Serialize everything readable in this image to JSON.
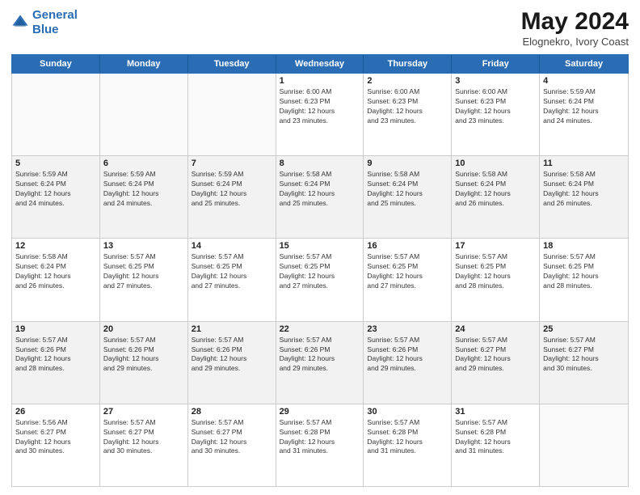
{
  "header": {
    "logo_line1": "General",
    "logo_line2": "Blue",
    "main_title": "May 2024",
    "subtitle": "Elognekro, Ivory Coast"
  },
  "days_of_week": [
    "Sunday",
    "Monday",
    "Tuesday",
    "Wednesday",
    "Thursday",
    "Friday",
    "Saturday"
  ],
  "weeks": [
    [
      {
        "day": "",
        "info": ""
      },
      {
        "day": "",
        "info": ""
      },
      {
        "day": "",
        "info": ""
      },
      {
        "day": "1",
        "info": "Sunrise: 6:00 AM\nSunset: 6:23 PM\nDaylight: 12 hours\nand 23 minutes."
      },
      {
        "day": "2",
        "info": "Sunrise: 6:00 AM\nSunset: 6:23 PM\nDaylight: 12 hours\nand 23 minutes."
      },
      {
        "day": "3",
        "info": "Sunrise: 6:00 AM\nSunset: 6:23 PM\nDaylight: 12 hours\nand 23 minutes."
      },
      {
        "day": "4",
        "info": "Sunrise: 5:59 AM\nSunset: 6:24 PM\nDaylight: 12 hours\nand 24 minutes."
      }
    ],
    [
      {
        "day": "5",
        "info": "Sunrise: 5:59 AM\nSunset: 6:24 PM\nDaylight: 12 hours\nand 24 minutes."
      },
      {
        "day": "6",
        "info": "Sunrise: 5:59 AM\nSunset: 6:24 PM\nDaylight: 12 hours\nand 24 minutes."
      },
      {
        "day": "7",
        "info": "Sunrise: 5:59 AM\nSunset: 6:24 PM\nDaylight: 12 hours\nand 25 minutes."
      },
      {
        "day": "8",
        "info": "Sunrise: 5:58 AM\nSunset: 6:24 PM\nDaylight: 12 hours\nand 25 minutes."
      },
      {
        "day": "9",
        "info": "Sunrise: 5:58 AM\nSunset: 6:24 PM\nDaylight: 12 hours\nand 25 minutes."
      },
      {
        "day": "10",
        "info": "Sunrise: 5:58 AM\nSunset: 6:24 PM\nDaylight: 12 hours\nand 26 minutes."
      },
      {
        "day": "11",
        "info": "Sunrise: 5:58 AM\nSunset: 6:24 PM\nDaylight: 12 hours\nand 26 minutes."
      }
    ],
    [
      {
        "day": "12",
        "info": "Sunrise: 5:58 AM\nSunset: 6:24 PM\nDaylight: 12 hours\nand 26 minutes."
      },
      {
        "day": "13",
        "info": "Sunrise: 5:57 AM\nSunset: 6:25 PM\nDaylight: 12 hours\nand 27 minutes."
      },
      {
        "day": "14",
        "info": "Sunrise: 5:57 AM\nSunset: 6:25 PM\nDaylight: 12 hours\nand 27 minutes."
      },
      {
        "day": "15",
        "info": "Sunrise: 5:57 AM\nSunset: 6:25 PM\nDaylight: 12 hours\nand 27 minutes."
      },
      {
        "day": "16",
        "info": "Sunrise: 5:57 AM\nSunset: 6:25 PM\nDaylight: 12 hours\nand 27 minutes."
      },
      {
        "day": "17",
        "info": "Sunrise: 5:57 AM\nSunset: 6:25 PM\nDaylight: 12 hours\nand 28 minutes."
      },
      {
        "day": "18",
        "info": "Sunrise: 5:57 AM\nSunset: 6:25 PM\nDaylight: 12 hours\nand 28 minutes."
      }
    ],
    [
      {
        "day": "19",
        "info": "Sunrise: 5:57 AM\nSunset: 6:26 PM\nDaylight: 12 hours\nand 28 minutes."
      },
      {
        "day": "20",
        "info": "Sunrise: 5:57 AM\nSunset: 6:26 PM\nDaylight: 12 hours\nand 29 minutes."
      },
      {
        "day": "21",
        "info": "Sunrise: 5:57 AM\nSunset: 6:26 PM\nDaylight: 12 hours\nand 29 minutes."
      },
      {
        "day": "22",
        "info": "Sunrise: 5:57 AM\nSunset: 6:26 PM\nDaylight: 12 hours\nand 29 minutes."
      },
      {
        "day": "23",
        "info": "Sunrise: 5:57 AM\nSunset: 6:26 PM\nDaylight: 12 hours\nand 29 minutes."
      },
      {
        "day": "24",
        "info": "Sunrise: 5:57 AM\nSunset: 6:27 PM\nDaylight: 12 hours\nand 29 minutes."
      },
      {
        "day": "25",
        "info": "Sunrise: 5:57 AM\nSunset: 6:27 PM\nDaylight: 12 hours\nand 30 minutes."
      }
    ],
    [
      {
        "day": "26",
        "info": "Sunrise: 5:56 AM\nSunset: 6:27 PM\nDaylight: 12 hours\nand 30 minutes."
      },
      {
        "day": "27",
        "info": "Sunrise: 5:57 AM\nSunset: 6:27 PM\nDaylight: 12 hours\nand 30 minutes."
      },
      {
        "day": "28",
        "info": "Sunrise: 5:57 AM\nSunset: 6:27 PM\nDaylight: 12 hours\nand 30 minutes."
      },
      {
        "day": "29",
        "info": "Sunrise: 5:57 AM\nSunset: 6:28 PM\nDaylight: 12 hours\nand 31 minutes."
      },
      {
        "day": "30",
        "info": "Sunrise: 5:57 AM\nSunset: 6:28 PM\nDaylight: 12 hours\nand 31 minutes."
      },
      {
        "day": "31",
        "info": "Sunrise: 5:57 AM\nSunset: 6:28 PM\nDaylight: 12 hours\nand 31 minutes."
      },
      {
        "day": "",
        "info": ""
      }
    ]
  ]
}
